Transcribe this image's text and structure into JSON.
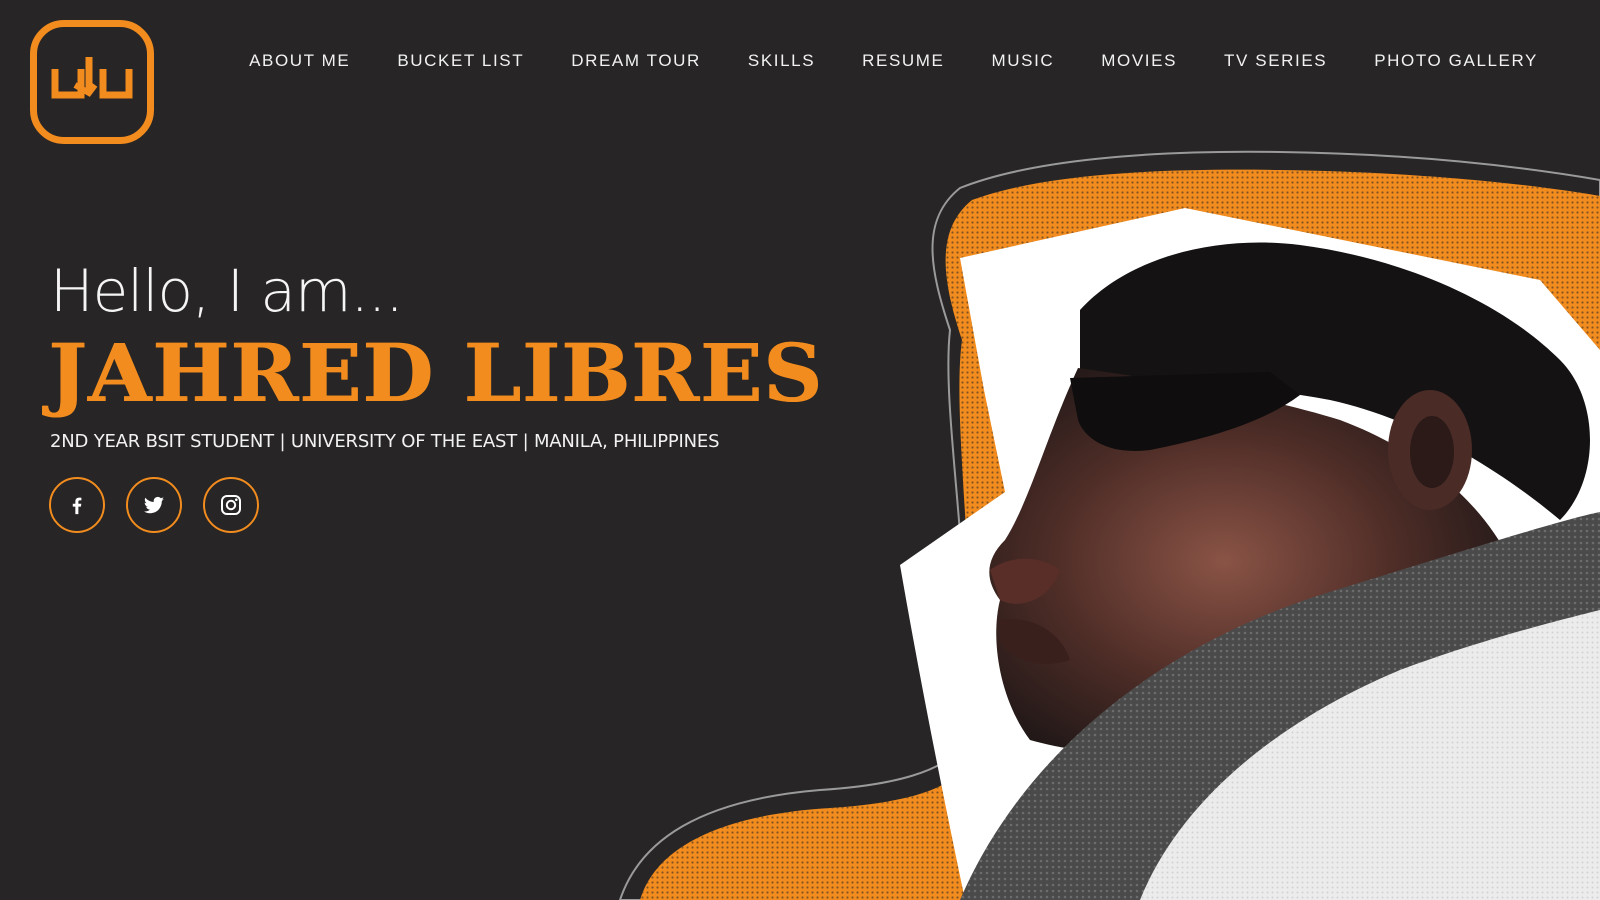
{
  "header": {
    "logo_text": "JL",
    "nav": [
      {
        "label": "ABOUT ME"
      },
      {
        "label": "BUCKET LIST"
      },
      {
        "label": "DREAM TOUR"
      },
      {
        "label": "SKILLS"
      },
      {
        "label": "RESUME"
      },
      {
        "label": "MUSIC"
      },
      {
        "label": "MOVIES"
      },
      {
        "label": "TV SERIES"
      },
      {
        "label": "PHOTO GALLERY"
      }
    ]
  },
  "hero": {
    "greeting": "Hello, I am...",
    "name": "JAHRED LIBRES",
    "tagline": "2ND YEAR BSIT STUDENT | UNIVERSITY OF THE EAST | MANILA, PHILIPPINES",
    "socials": [
      {
        "icon": "facebook-icon"
      },
      {
        "icon": "twitter-icon"
      },
      {
        "icon": "instagram-icon"
      }
    ]
  },
  "colors": {
    "background": "#272525",
    "accent": "#f28c1e",
    "text": "#f2f2f2"
  }
}
